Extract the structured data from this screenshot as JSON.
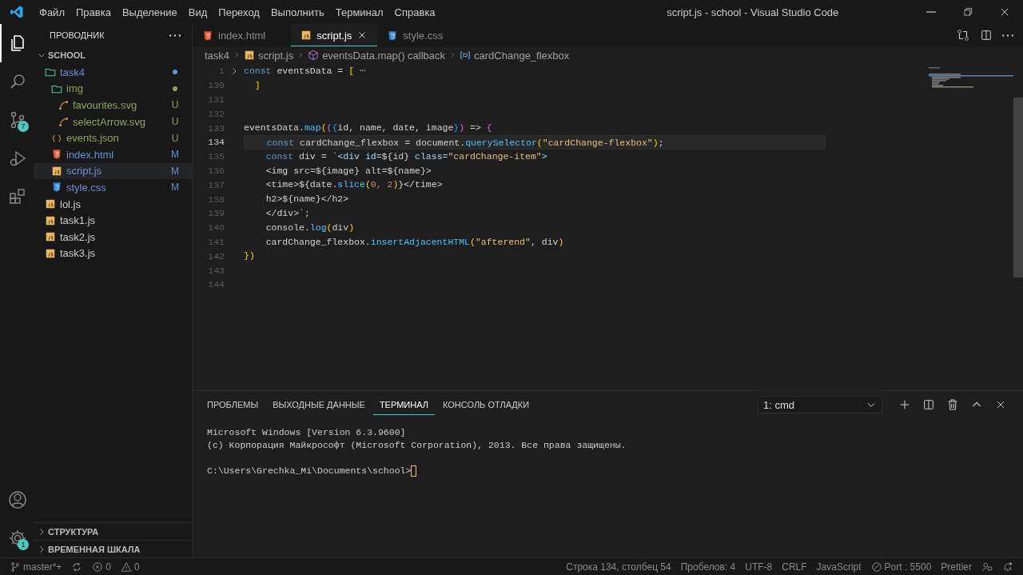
{
  "title_bar": {
    "menu": [
      "Файл",
      "Правка",
      "Выделение",
      "Вид",
      "Переход",
      "Выполнить",
      "Терминал",
      "Справка"
    ],
    "title": "script.js - school - Visual Studio Code"
  },
  "activity_bar": [
    {
      "kind": "files",
      "selected": true
    },
    {
      "kind": "search",
      "selected": false
    },
    {
      "kind": "source-control",
      "selected": false,
      "badge": "7"
    },
    {
      "kind": "run",
      "selected": false
    },
    {
      "kind": "extensions",
      "selected": false
    }
  ],
  "activity_bar_bottom": [
    {
      "kind": "account"
    },
    {
      "kind": "settings",
      "badge": "1"
    }
  ],
  "sidebar": {
    "title": "ПРОВОДНИК",
    "root": "SCHOOL",
    "tree": [
      {
        "name": "task4",
        "kind": "folder",
        "color": "#6b8fd6",
        "selected": false,
        "children": [
          {
            "name": "img",
            "kind": "folder",
            "color": "#8fa65a",
            "selected": false,
            "children": [
              {
                "name": "favourites.svg",
                "kind": "svg",
                "color": "#8fa65a",
                "badge": "U",
                "selected": false
              },
              {
                "name": "selectArrow.svg",
                "kind": "svg",
                "color": "#8fa65a",
                "badge": "U",
                "selected": false
              }
            ]
          },
          {
            "name": "events.json",
            "kind": "json",
            "color": "#8fa65a",
            "badge": "U",
            "selected": false
          },
          {
            "name": "index.html",
            "kind": "html",
            "color": "#6b8fd6",
            "badge": "M",
            "selected": false
          },
          {
            "name": "script.js",
            "kind": "js",
            "color": "#6b8fd6",
            "badge": "M",
            "selected": true
          },
          {
            "name": "style.css",
            "kind": "css",
            "color": "#6b8fd6",
            "badge": "M",
            "selected": false
          }
        ]
      },
      {
        "name": "lol.js",
        "kind": "js",
        "selected": false
      },
      {
        "name": "task1.js",
        "kind": "js",
        "selected": false
      },
      {
        "name": "task2.js",
        "kind": "js",
        "selected": false
      },
      {
        "name": "task3.js",
        "kind": "js",
        "selected": false
      }
    ],
    "sections": [
      "СТРУКТУРА",
      "ВРЕМЕННАЯ ШКАЛА"
    ]
  },
  "editor": {
    "tabs": [
      {
        "label": "index.html",
        "kind": "html",
        "selected": false
      },
      {
        "label": "script.js",
        "kind": "js",
        "selected": true
      },
      {
        "label": "style.css",
        "kind": "css",
        "selected": false
      }
    ],
    "breadcrumb": [
      {
        "label": "task4",
        "kind": "folder"
      },
      {
        "label": "script.js",
        "kind": "js"
      },
      {
        "label": "eventsData.map() callback",
        "kind": "method"
      },
      {
        "label": "cardChange_flexbox",
        "kind": "variable"
      }
    ],
    "lines": [
      {
        "num": "1",
        "folded": true,
        "current": false,
        "code": "const eventsData = [ ⋯"
      },
      {
        "num": "130",
        "folded": false,
        "current": false,
        "code": "  ]"
      },
      {
        "num": "131",
        "folded": false,
        "current": false
      },
      {
        "num": "132",
        "folded": false,
        "current": false
      },
      {
        "num": "133",
        "folded": false,
        "current": false,
        "code": "eventsData.map(({id, name, date, image}) => {"
      },
      {
        "num": "134",
        "folded": false,
        "current": true,
        "code": "    const cardChange_flexbox = document.querySelector(\"cardChange-flexbox\");"
      },
      {
        "num": "135",
        "folded": false,
        "current": false,
        "code": "    const div = `<div id=${id} class=\"cardChange-item\">"
      },
      {
        "num": "136",
        "folded": false,
        "current": false,
        "code": "    <img src=${image} alt=${name}>"
      },
      {
        "num": "137",
        "folded": false,
        "current": false,
        "code": "    <time>${date.slice(0, 2)}</time>"
      },
      {
        "num": "138",
        "folded": false,
        "current": false,
        "code": "    h2>${name}</h2>"
      },
      {
        "num": "139",
        "folded": false,
        "current": false,
        "code": "    </div>`;"
      },
      {
        "num": "140",
        "folded": false,
        "current": false,
        "code": "    console.log(div)"
      },
      {
        "num": "141",
        "folded": false,
        "current": false,
        "code": "    cardChange_flexbox.insertAdjacentHTML(\"afterend\", div)"
      },
      {
        "num": "142",
        "folded": false,
        "current": false,
        "code": "})"
      },
      {
        "num": "143",
        "folded": false,
        "current": false
      },
      {
        "num": "144",
        "folded": false,
        "current": false
      }
    ]
  },
  "panel": {
    "tabs": [
      {
        "label": "ПРОБЛЕМЫ",
        "selected": false
      },
      {
        "label": "ВЫХОДНЫЕ ДАННЫЕ",
        "selected": false
      },
      {
        "label": "ТЕРМИНАЛ",
        "selected": true
      },
      {
        "label": "КОНСОЛЬ ОТЛАДКИ",
        "selected": false
      }
    ],
    "terminal_select": "1: cmd",
    "terminal": [
      "Microsoft Windows [Version 6.3.9600]",
      "(c) Корпорация Майкрософт (Microsoft Corporation), 2013. Все права защищены."
    ],
    "prompt": "C:\\Users\\Grechka_Mi\\Documents\\school>"
  },
  "status_bar": {
    "left": [
      {
        "kind": "branch",
        "text": "master*+"
      },
      {
        "kind": "sync"
      },
      {
        "kind": "errors",
        "text": "0"
      },
      {
        "kind": "warnings",
        "text": "0"
      }
    ],
    "right": [
      {
        "kind": "text",
        "text": "Строка 134, столбец 54"
      },
      {
        "kind": "text",
        "text": "Пробелов: 4"
      },
      {
        "kind": "text",
        "text": "UTF-8"
      },
      {
        "kind": "text",
        "text": "CRLF"
      },
      {
        "kind": "text",
        "text": "JavaScript"
      },
      {
        "kind": "port",
        "text": "Port : 5500"
      },
      {
        "kind": "text",
        "text": "Prettier"
      },
      {
        "kind": "feedback"
      },
      {
        "kind": "bell"
      }
    ]
  }
}
